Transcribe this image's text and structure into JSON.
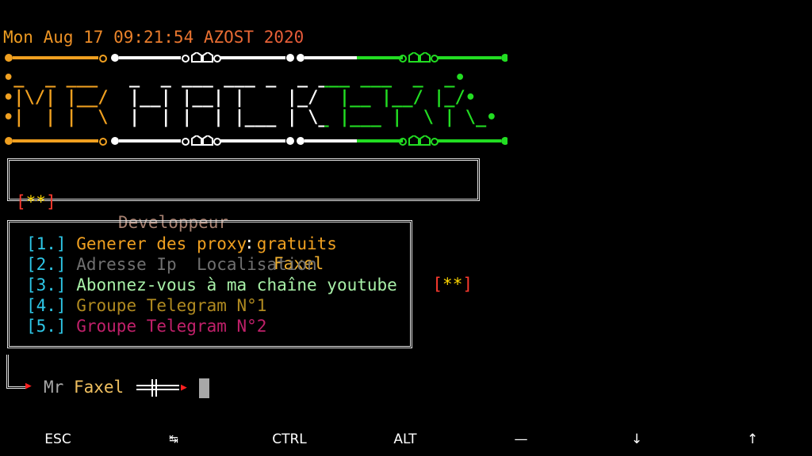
{
  "header": {
    "datetime": "Mon Aug 17 09:21:54 AZOST 2020",
    "colors": {
      "orange": "#f0a020",
      "white": "#ffffff",
      "green": "#22dd22"
    }
  },
  "banner": {
    "lines": [
      "•_  _ ___   _  _ ___ ___ _  _ ___ ___  _  _•",
      "•|\\/| |__/  |__| |__| |    |_/  |__ |__/ |_/•",
      "•|  | |  \\  |  | |  | |___ | \\_ |___ |  \\ | \\_•"
    ]
  },
  "developer_box": {
    "left_tag": "[**]",
    "label": "Developpeur",
    "separator": ":",
    "name": "Faxel",
    "right_tag": "[**]"
  },
  "menu": {
    "items": [
      {
        "number": "[1.]",
        "label": "Generer des proxy gratuits",
        "color": "#f0a020"
      },
      {
        "number": "[2.]",
        "label": "Adresse Ip  Localisation",
        "color": "#707070"
      },
      {
        "number": "[3.]",
        "label": "Abonnez-vous à ma chaîne youtube",
        "color": "#a8f0a8"
      },
      {
        "number": "[4.]",
        "label": "Groupe Telegram N°1",
        "color": "#b08a20"
      },
      {
        "number": "[5.]",
        "label": "Groupe Telegram N°2",
        "color": "#c0206a"
      }
    ]
  },
  "prompt": {
    "prefix": "Mr",
    "user": "Faxel",
    "arrow_icon": "right-arrow-icon",
    "connector_icon": "cross-connector-icon"
  },
  "extra_keys": [
    "ESC",
    "↹",
    "CTRL",
    "ALT",
    "—",
    "↓",
    "↑"
  ]
}
